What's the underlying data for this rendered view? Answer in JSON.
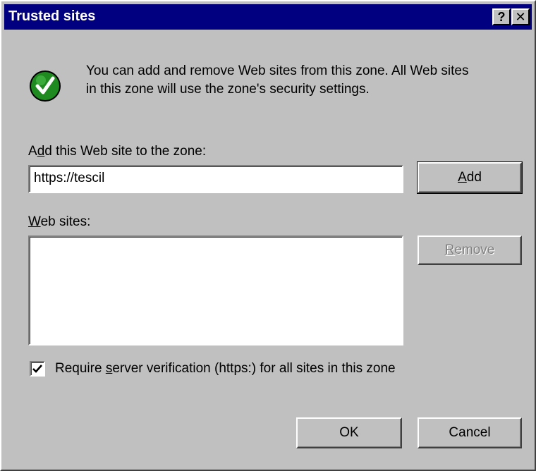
{
  "window": {
    "title": "Trusted sites",
    "help_glyph": "?",
    "close_glyph": "✕"
  },
  "intro": {
    "icon": "green-check-shield-icon",
    "line1": "You can add and remove Web sites from this zone. All Web sites",
    "line2": "in this zone will use the zone's security settings."
  },
  "add_site": {
    "label_accel": "d",
    "label_pre": "A",
    "label_post": "d this Web site to the zone:",
    "value": "https://tescil",
    "button_accel": "A",
    "button_rest": "dd"
  },
  "sites": {
    "label_accel": "W",
    "label_rest": "eb sites:",
    "items": [],
    "remove_accel": "R",
    "remove_rest": "emove"
  },
  "verification": {
    "checked": true,
    "label_pre": "Require ",
    "label_accel": "s",
    "label_post": "erver verification (https:) for all sites in this zone"
  },
  "footer": {
    "ok_label": "OK",
    "cancel_label": "Cancel"
  },
  "colors": {
    "titlebar": "#000080",
    "face": "#c0c0c0",
    "icon_green": "#1f8a1f"
  }
}
